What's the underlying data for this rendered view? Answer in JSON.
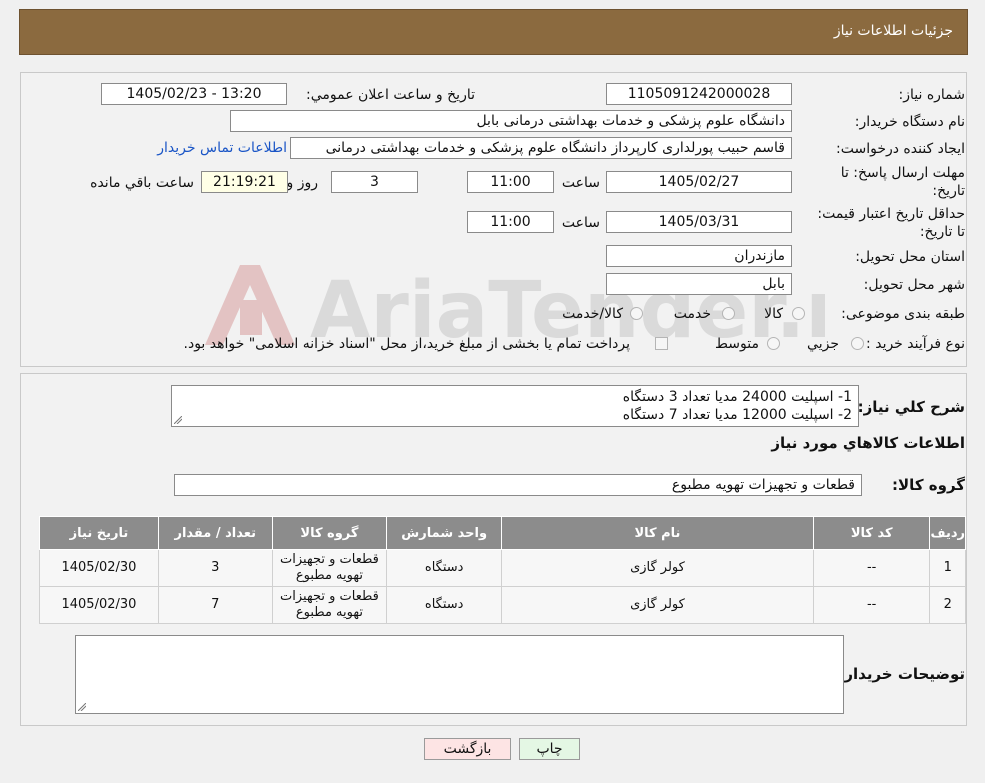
{
  "header": {
    "title": "جزئیات اطلاعات نیاز"
  },
  "form": {
    "need_number_label": "شماره نیاز:",
    "need_number": "1105091242000028",
    "announce_label": "تاریخ و ساعت اعلان عمومي:",
    "announce_value": "1405/02/23 - 13:20",
    "buyer_org_label": "نام دستگاه خریدار:",
    "buyer_org": "دانشگاه علوم پزشکی و خدمات بهداشتی  درمانی بابل",
    "creator_label": "ایجاد کننده درخواست:",
    "creator": "قاسم حبیب پورلداری کارپرداز دانشگاه علوم پزشکی و خدمات بهداشتی  درمانی",
    "contact_link": "اطلاعات تماس خریدار",
    "reply_deadline_label": "مهلت ارسال پاسخ: تا تاریخ:",
    "reply_date": "1405/02/27",
    "time_label": "ساعت",
    "reply_time": "11:00",
    "days_value": "3",
    "days_label": "روز و",
    "remaining_time": "21:19:21",
    "remaining_label": "ساعت باقي مانده",
    "price_validity_label": "حداقل تاریخ اعتبار قیمت: تا تاریخ:",
    "price_date": "1405/03/31",
    "price_time": "11:00",
    "province_label": "استان محل تحویل:",
    "province": "مازندران",
    "city_label": "شهر محل تحویل:",
    "city": "بابل",
    "category_label": "طبقه بندی موضوعی:",
    "category_options": [
      "کالا",
      "خدمت",
      "کالا/خدمت"
    ],
    "process_label": "نوع فرآیند خرید :",
    "process_options": [
      "جزيي",
      "متوسط"
    ],
    "process_note": "پرداخت تمام یا بخشی از مبلغ خرید،از محل \"اسناد خزانه اسلامی\" خواهد بود."
  },
  "summary": {
    "label": "شرح کلي نیاز:",
    "lines": [
      "1- اسپلیت 24000 مدیا تعداد 3 دستگاه",
      "2- اسپلیت 12000 مدیا تعداد 7 دستگاه"
    ]
  },
  "goods": {
    "section_title": "اطلاعات کالاهاي مورد نیاز",
    "group_label": "گروه کالا:",
    "group_value": "قطعات و تجهیزات تهویه مطبوع",
    "columns": [
      "ردیف",
      "کد کالا",
      "نام کالا",
      "واحد شمارش",
      "گروه کالا",
      "تعداد / مقدار",
      "تاریخ نیاز"
    ],
    "rows": [
      {
        "row": "1",
        "code": "--",
        "name": "کولر گازی",
        "unit": "دستگاه",
        "group": "قطعات و تجهیزات تهویه مطبوع",
        "qty": "3",
        "date": "1405/02/30"
      },
      {
        "row": "2",
        "code": "--",
        "name": "کولر گازی",
        "unit": "دستگاه",
        "group": "قطعات و تجهیزات تهویه مطبوع",
        "qty": "7",
        "date": "1405/02/30"
      }
    ]
  },
  "notes": {
    "label": "توضیحات خریدار:"
  },
  "buttons": {
    "print": "چاپ",
    "back": "بازگشت"
  },
  "watermark": {
    "text": "AriaTender.neT"
  }
}
